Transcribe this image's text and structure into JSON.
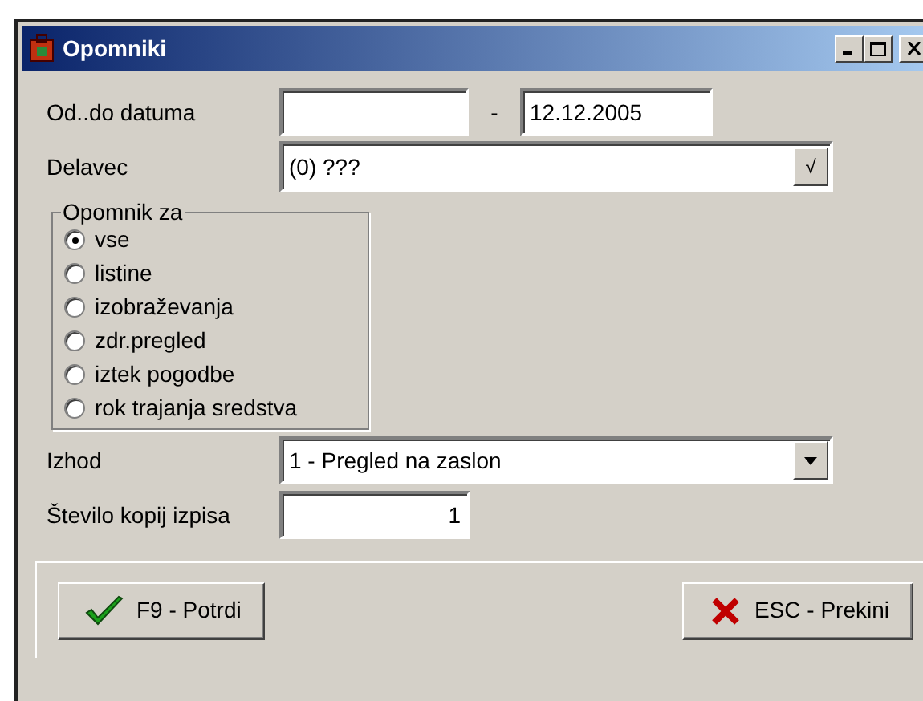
{
  "window": {
    "title": "Opomniki"
  },
  "date_range": {
    "label": "Od..do datuma",
    "separator": "-",
    "to": "12.12.2005"
  },
  "worker": {
    "label": "Delavec",
    "value": "(0) ???",
    "button": "√"
  },
  "reminder_for": {
    "title": "Opomnik za",
    "options": [
      {
        "label": "vse",
        "selected": true
      },
      {
        "label": "listine",
        "selected": false
      },
      {
        "label": "izobraževanja",
        "selected": false
      },
      {
        "label": "zdr.pregled",
        "selected": false
      },
      {
        "label": "iztek pogodbe",
        "selected": false
      },
      {
        "label": "rok trajanja sredstva",
        "selected": false
      }
    ]
  },
  "output": {
    "label": "Izhod",
    "value": "1 - Pregled na zaslon"
  },
  "copies": {
    "label": "Število kopij izpisa",
    "value": "1"
  },
  "buttons": [
    {
      "kind": "confirm",
      "label": "F9 - Potrdi"
    },
    {
      "kind": "cancel",
      "label": "ESC - Prekini"
    }
  ]
}
